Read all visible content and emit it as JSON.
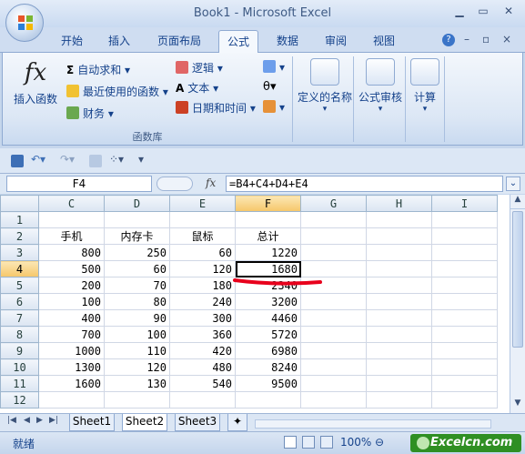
{
  "window": {
    "title": "Book1 - Microsoft Excel"
  },
  "tabs": [
    {
      "label": "开始"
    },
    {
      "label": "插入"
    },
    {
      "label": "页面布局"
    },
    {
      "label": "公式"
    },
    {
      "label": "数据"
    },
    {
      "label": "审阅"
    },
    {
      "label": "视图"
    }
  ],
  "ribbon": {
    "insert_function": "插入函数",
    "autosum": "自动求和",
    "recent": "最近使用的函数",
    "finance": "财务",
    "logic": "逻辑",
    "text": "文本",
    "datetime": "日期和时间",
    "group_label": "函数库",
    "defined_names": "定义的名称",
    "formula_audit": "公式审核",
    "calculate": "计算"
  },
  "formula_bar": {
    "name_box": "F4",
    "fx": "fx",
    "formula": "=B4+C4+D4+E4"
  },
  "grid": {
    "columns": [
      "C",
      "D",
      "E",
      "F",
      "G",
      "H",
      "I"
    ],
    "rows": [
      {
        "n": "1",
        "cells": [
          "",
          "",
          "",
          "",
          "",
          "",
          ""
        ]
      },
      {
        "n": "2",
        "cells": [
          "手机",
          "内存卡",
          "鼠标",
          "总计",
          "",
          "",
          ""
        ]
      },
      {
        "n": "3",
        "cells": [
          "800",
          "250",
          "60",
          "1220",
          "",
          "",
          ""
        ]
      },
      {
        "n": "4",
        "cells": [
          "500",
          "60",
          "120",
          "1680",
          "",
          "",
          ""
        ]
      },
      {
        "n": "5",
        "cells": [
          "200",
          "70",
          "180",
          "2340",
          "",
          "",
          ""
        ]
      },
      {
        "n": "6",
        "cells": [
          "100",
          "80",
          "240",
          "3200",
          "",
          "",
          ""
        ]
      },
      {
        "n": "7",
        "cells": [
          "400",
          "90",
          "300",
          "4460",
          "",
          "",
          ""
        ]
      },
      {
        "n": "8",
        "cells": [
          "700",
          "100",
          "360",
          "5720",
          "",
          "",
          ""
        ]
      },
      {
        "n": "9",
        "cells": [
          "1000",
          "110",
          "420",
          "6980",
          "",
          "",
          ""
        ]
      },
      {
        "n": "10",
        "cells": [
          "1300",
          "120",
          "480",
          "8240",
          "",
          "",
          ""
        ]
      },
      {
        "n": "11",
        "cells": [
          "1600",
          "130",
          "540",
          "9500",
          "",
          "",
          ""
        ]
      },
      {
        "n": "12",
        "cells": [
          "",
          "",
          "",
          "",
          "",
          "",
          ""
        ]
      }
    ]
  },
  "sheets": [
    {
      "label": "Sheet1"
    },
    {
      "label": "Sheet2"
    },
    {
      "label": "Sheet3"
    }
  ],
  "status": {
    "ready": "就绪",
    "zoom": "100%"
  },
  "watermark": "Excelcn.com",
  "colors": {
    "annotation": "#e8001c",
    "selection_header": "#f6c769",
    "ribbon": "#dce7f5"
  }
}
